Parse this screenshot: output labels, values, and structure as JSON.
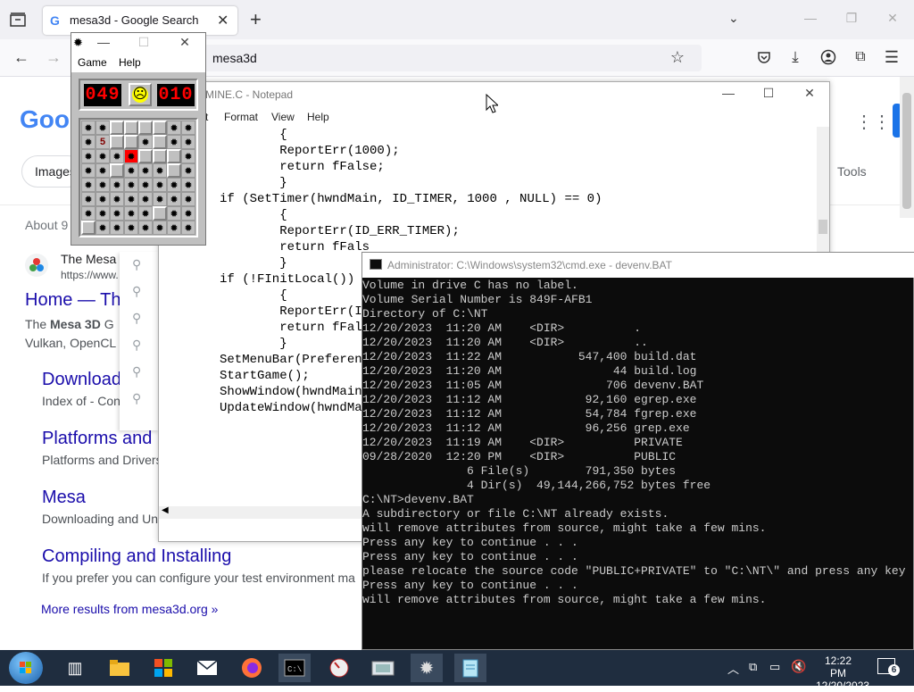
{
  "browser": {
    "tab_title": "mesa3d - Google Search",
    "new_tab": "+",
    "url": "mesa3d"
  },
  "google": {
    "images_tab": "Images",
    "tools": "Tools",
    "about": "About 9",
    "result_site_name": "The Mesa",
    "result_site_url": "https://www.",
    "main_title": "Home — Th",
    "main_snip_1_pre": "The ",
    "main_snip_1_bold": "Mesa 3D",
    "main_snip_1_post": " G",
    "main_snip_2": "Vulkan, OpenCL",
    "sub": [
      {
        "title": "Download",
        "snip": "Index of - Con"
      },
      {
        "title": "Platforms and",
        "snip": "Platforms and Drivers"
      },
      {
        "title": "Mesa",
        "snip": "Downloading and Un"
      },
      {
        "title": "Compiling and Installing",
        "snip": "If you prefer you can configure your test environment ma"
      }
    ],
    "more_results": "More results from mesa3d.org »"
  },
  "notepad": {
    "title": "MINE.C - Notepad",
    "menu": [
      "t",
      "Format",
      "View",
      "Help"
    ],
    "lines": [
      "        {",
      "        ReportErr(1000);",
      "        return fFalse;",
      "        }",
      "",
      "if (SetTimer(hwndMain, ID_TIMER, 1000 , NULL) == 0)",
      "        {",
      "        ReportErr(ID_ERR_TIMER);",
      "        return fFals",
      "        }",
      "",
      "if (!FInitLocal())",
      "        {",
      "        ReportErr(ID",
      "        return fFals",
      "        }",
      "",
      "SetMenuBar(Preferenc",
      "",
      "StartGame();",
      "",
      "ShowWindow(hwndMain,",
      "UpdateWindow(hwndMai"
    ]
  },
  "cmd": {
    "title": "Administrator: C:\\Windows\\system32\\cmd.exe - devenv.BAT",
    "lines": [
      "Volume in drive C has no label.",
      "Volume Serial Number is 849F-AFB1",
      "",
      "Directory of C:\\NT",
      "",
      "12/20/2023  11:20 AM    <DIR>          .",
      "12/20/2023  11:20 AM    <DIR>          ..",
      "12/20/2023  11:22 AM           547,400 build.dat",
      "12/20/2023  11:20 AM                44 build.log",
      "12/20/2023  11:05 AM               706 devenv.BAT",
      "12/20/2023  11:12 AM            92,160 egrep.exe",
      "12/20/2023  11:12 AM            54,784 fgrep.exe",
      "12/20/2023  11:12 AM            96,256 grep.exe",
      "12/20/2023  11:19 AM    <DIR>          PRIVATE",
      "09/28/2020  12:20 PM    <DIR>          PUBLIC",
      "               6 File(s)        791,350 bytes",
      "               4 Dir(s)  49,144,266,752 bytes free",
      "",
      "C:\\NT>devenv.BAT",
      "A subdirectory or file C:\\NT already exists.",
      "will remove attributes from source, might take a few mins.",
      "Press any key to continue . . .",
      "Press any key to continue . . .",
      "please relocate the source code \"PUBLIC+PRIVATE\" to \"C:\\NT\\\" and press any key",
      "Press any key to continue . . .",
      "will remove attributes from source, might take a few mins."
    ]
  },
  "minesweeper": {
    "menu": [
      "Game",
      "Help"
    ],
    "mines_left": "049",
    "timer": "010",
    "face": "☹",
    "grid": [
      "MMUUUUMM",
      "M5UUMUMM",
      "MMMXUUUM",
      "MMUMMMUM",
      "MMMMMMMM",
      "MMMMMMMM",
      "MMMMMUMM",
      "UMMMMMMM"
    ]
  },
  "taskbar": {
    "time": "12:22 PM",
    "date": "12/20/2023",
    "notifications": "6"
  }
}
